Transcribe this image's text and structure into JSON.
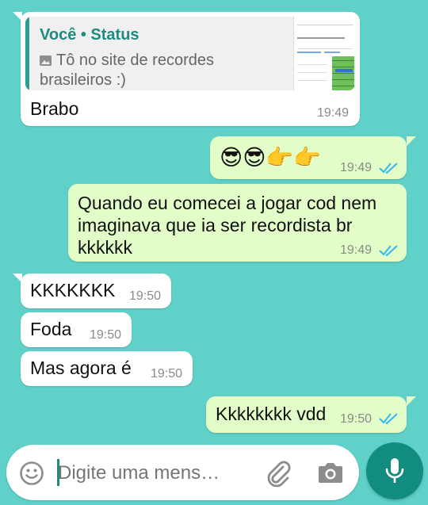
{
  "messages": [
    {
      "direction": "incoming",
      "reply": {
        "author": "Você • Status",
        "media_icon": "image-icon",
        "text": "Tô no site de recordes brasileiros :)"
      },
      "text": "Brabo",
      "time": "19:49"
    },
    {
      "direction": "outgoing",
      "text": "😎😎👉👉",
      "time": "19:49",
      "status": "read"
    },
    {
      "direction": "outgoing",
      "text": "Quando eu comecei a jogar cod nem imaginava que ia ser recordista br kkkkkk",
      "time": "19:49",
      "status": "read"
    },
    {
      "direction": "incoming",
      "text": "KKKKKKK",
      "time": "19:50"
    },
    {
      "direction": "incoming",
      "text": "Foda",
      "time": "19:50"
    },
    {
      "direction": "incoming",
      "text": "Mas agora é",
      "time": "19:50"
    },
    {
      "direction": "outgoing",
      "text": "Kkkkkkkk vdd",
      "time": "19:50",
      "status": "read"
    }
  ],
  "composer": {
    "placeholder": "Digite uma mens…",
    "icons": [
      "emoji-icon",
      "attach-icon",
      "camera-icon",
      "microphone-icon"
    ]
  },
  "colors": {
    "wallpaper": "#5fd1c9",
    "incoming": "#ffffff",
    "outgoing": "#e2fdc7",
    "accent": "#128c7e",
    "read_ticks": "#34b7f1"
  }
}
